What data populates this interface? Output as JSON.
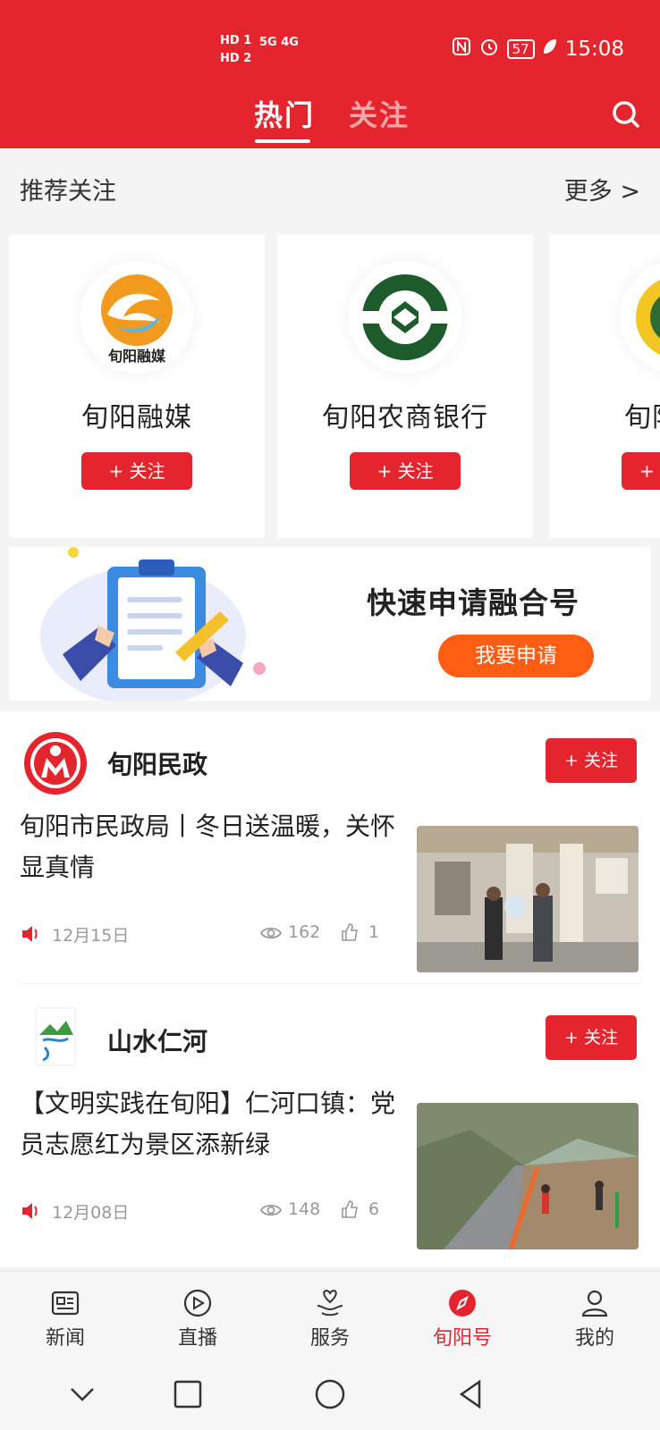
{
  "status_bar": {
    "hd1": "HD 1",
    "hd2": "HD 2",
    "network": "5G 4G",
    "battery": "57",
    "time": "15:08"
  },
  "tabs": {
    "hot": "热门",
    "follow": "关注"
  },
  "recommend": {
    "title": "推荐关注",
    "more": "更多 >",
    "cards": [
      {
        "name": "旬阳融媒",
        "logo_text": "旬阳融媒",
        "follow": "+ 关注"
      },
      {
        "name": "旬阳农商银行",
        "follow": "+ 关注"
      },
      {
        "name": "旬阳",
        "follow": "+"
      }
    ]
  },
  "banner": {
    "title": "快速申请融合号",
    "button": "我要申请"
  },
  "feed": [
    {
      "source": "旬阳民政",
      "follow": "+ 关注",
      "headline": "旬阳市民政局丨冬日送温暖，关怀显真情",
      "date": "12月15日",
      "views": "162",
      "likes": "1"
    },
    {
      "source": "山水仁河",
      "follow": "+ 关注",
      "headline": "【文明实践在旬阳】仁河口镇：党员志愿红为景区添新绿",
      "date": "12月08日",
      "views": "148",
      "likes": "6"
    }
  ],
  "bottom_nav": [
    {
      "label": "新闻",
      "icon": "news-icon"
    },
    {
      "label": "直播",
      "icon": "live-icon"
    },
    {
      "label": "服务",
      "icon": "service-icon"
    },
    {
      "label": "旬阳号",
      "icon": "compass-icon",
      "active": true
    },
    {
      "label": "我的",
      "icon": "profile-icon"
    }
  ],
  "colors": {
    "brand": "#e4252d",
    "accent_orange": "#ff5d14"
  }
}
